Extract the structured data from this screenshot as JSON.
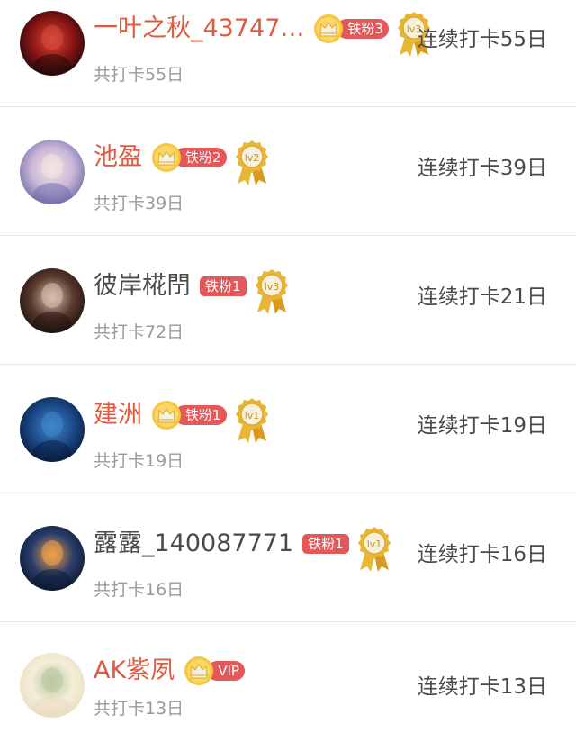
{
  "users": [
    {
      "name": "一叶之秋_43747…",
      "name_red": true,
      "badge": {
        "crown": true,
        "label": "铁粉3"
      },
      "medal": "lv3",
      "total": "共打卡55日",
      "streak": "连续打卡55日",
      "avatar_colors": [
        "#1a0a0a",
        "#8a1414",
        "#d94a3a"
      ]
    },
    {
      "name": "池盈",
      "name_red": true,
      "badge": {
        "crown": true,
        "label": "铁粉2"
      },
      "medal": "lv2",
      "total": "共打卡39日",
      "streak": "连续打卡39日",
      "avatar_colors": [
        "#6e6aa8",
        "#c9b6d8",
        "#f3e6e0"
      ]
    },
    {
      "name": "彼岸椛閅",
      "name_red": false,
      "badge": {
        "crown": false,
        "label": "铁粉1"
      },
      "medal": "lv3",
      "total": "共打卡72日",
      "streak": "连续打卡21日",
      "avatar_colors": [
        "#1b0f0c",
        "#5a3a2e",
        "#d8c0b0"
      ]
    },
    {
      "name": "建洲",
      "name_red": true,
      "badge": {
        "crown": true,
        "label": "铁粉1"
      },
      "medal": "lv1",
      "total": "共打卡19日",
      "streak": "连续打卡19日",
      "avatar_colors": [
        "#061a3a",
        "#1c4a8a",
        "#3f86c8"
      ]
    },
    {
      "name": "露露_140087771",
      "name_red": false,
      "badge": {
        "crown": false,
        "label": "铁粉1"
      },
      "medal": "lv1",
      "total": "共打卡16日",
      "streak": "连续打卡16日",
      "avatar_colors": [
        "#0a1630",
        "#2a3e6a",
        "#f2a048"
      ]
    },
    {
      "name": "AK紫夙",
      "name_red": true,
      "badge": {
        "crown": true,
        "label": "VIP"
      },
      "medal": "",
      "total": "共打卡13日",
      "streak": "连续打卡13日",
      "avatar_colors": [
        "#e8dcc0",
        "#f5eed8",
        "#b8c8a0"
      ]
    }
  ],
  "colors": {
    "name_red": "#e05a3f",
    "pill": "#e4585a",
    "gold": "#e8b534"
  }
}
